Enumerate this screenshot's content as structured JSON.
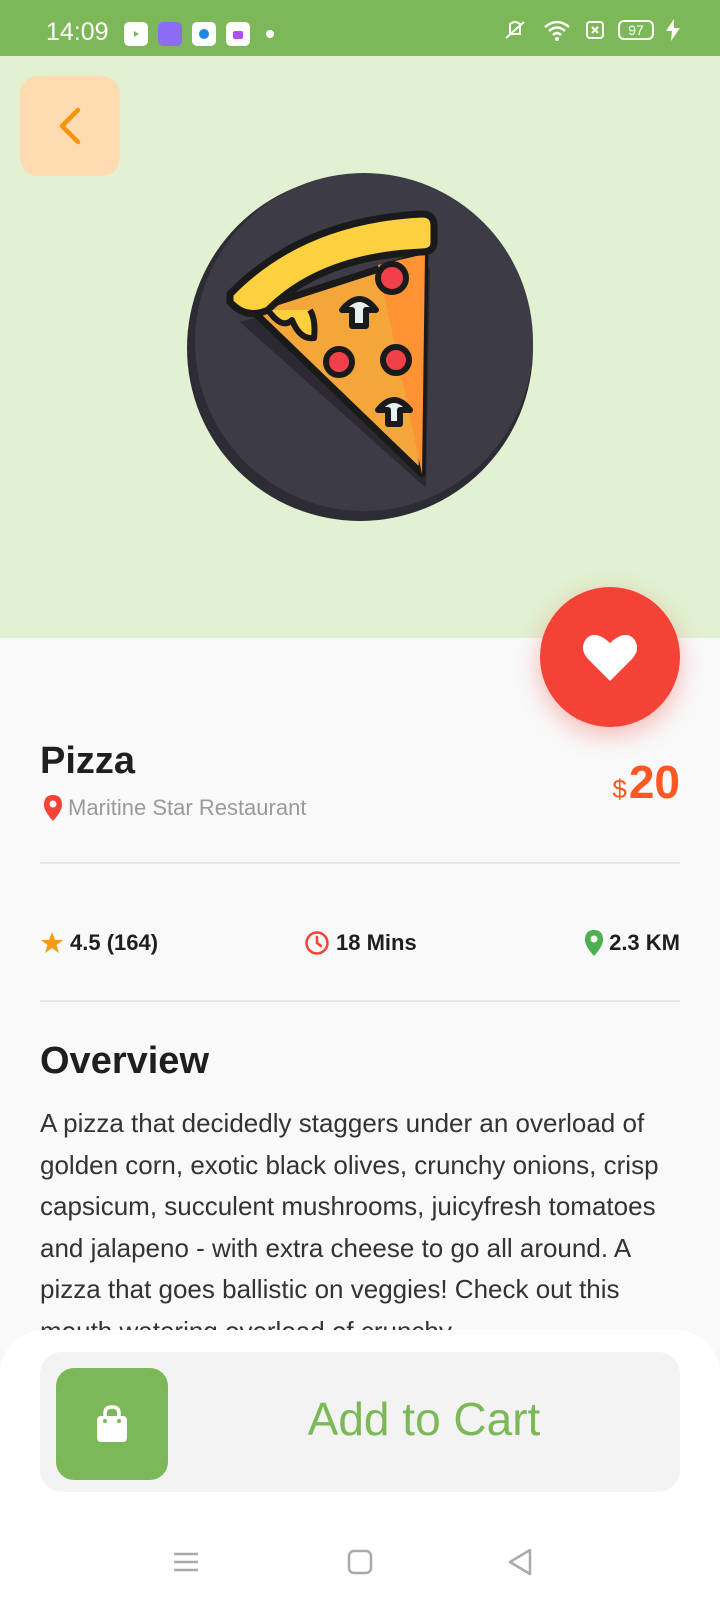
{
  "status_bar": {
    "time": "14:09",
    "battery": "97"
  },
  "hero": {
    "image": "pizza-slice-icon",
    "background": "#e1f1d2"
  },
  "product": {
    "name": "Pizza",
    "restaurant": "Maritine Star Restaurant",
    "price_currency": "$",
    "price_amount": "20",
    "favorite": true
  },
  "stats": {
    "rating": "4.5 (164)",
    "time": "18 Mins",
    "distance": "2.3 KM"
  },
  "overview": {
    "heading": "Overview",
    "text": "A pizza that decidedly staggers under an overload of golden corn, exotic black olives, crunchy onions, crisp capsicum, succulent mushrooms, juicyfresh tomatoes and jalapeno - with extra cheese to go all around. A pizza that goes ballistic on veggies! Check out this mouth watering overload of crunchy"
  },
  "cart": {
    "label": "Add to Cart"
  },
  "colors": {
    "brand_green": "#7db858",
    "accent_orange": "#ff5722",
    "favorite_red": "#f44336",
    "back_button_bg": "#ffdbaf"
  }
}
